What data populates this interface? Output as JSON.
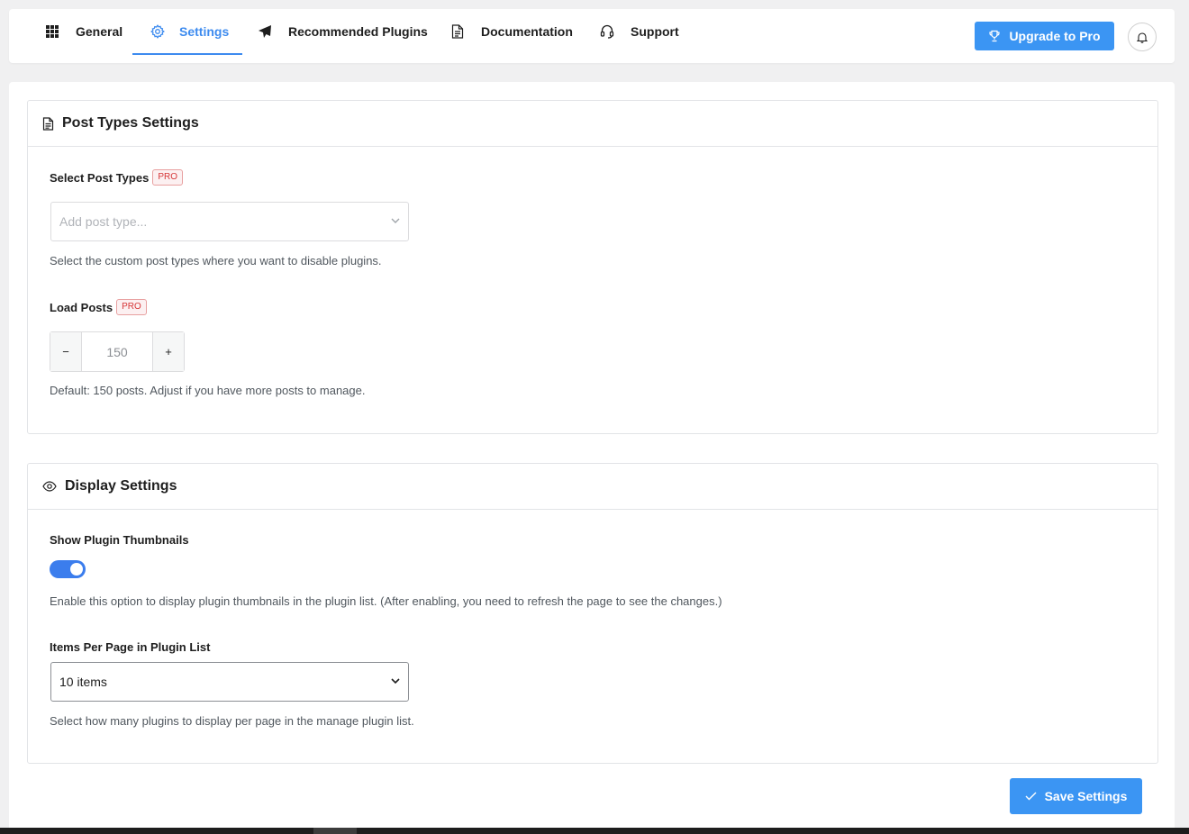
{
  "nav": {
    "tabs": [
      {
        "label": "General",
        "icon": "grid-icon"
      },
      {
        "label": "Settings",
        "icon": "gear-icon",
        "active": true
      },
      {
        "label": "Recommended Plugins",
        "icon": "paper-plane-icon"
      },
      {
        "label": "Documentation",
        "icon": "document-icon"
      },
      {
        "label": "Support",
        "icon": "headset-icon"
      }
    ],
    "upgrade_label": "Upgrade to Pro"
  },
  "post_types": {
    "title": "Post Types Settings",
    "select_label": "Select Post Types",
    "pro_badge": "PRO",
    "select_placeholder": "Add post type...",
    "select_help": "Select the custom post types where you want to disable plugins.",
    "load_label": "Load Posts",
    "load_minus": "−",
    "load_value": "150",
    "load_plus": "+",
    "load_help": "Default: 150 posts. Adjust if you have more posts to manage."
  },
  "display": {
    "title": "Display Settings",
    "thumbnails_label": "Show Plugin Thumbnails",
    "thumbnails_enabled": true,
    "thumbnails_help": "Enable this option to display plugin thumbnails in the plugin list. (After enabling, you need to refresh the page to see the changes.)",
    "items_label": "Items Per Page in Plugin List",
    "items_value": "10 items",
    "items_help": "Select how many plugins to display per page in the manage plugin list."
  },
  "save_label": "Save Settings",
  "colors": {
    "accent": "#3b95f3",
    "toggle": "#3b7ded",
    "pro": "#d63638"
  }
}
